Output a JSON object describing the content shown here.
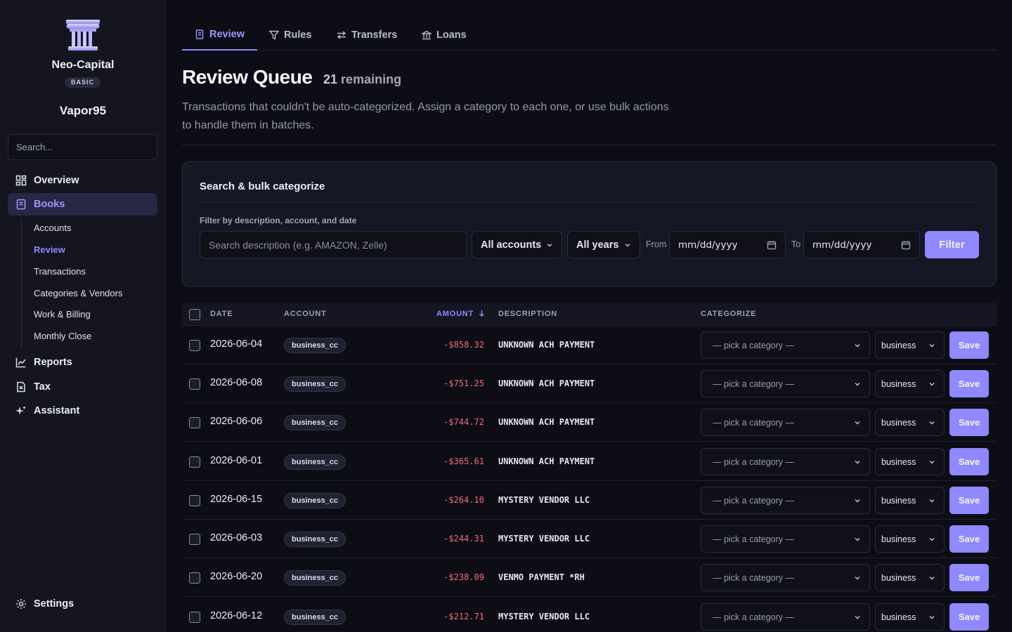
{
  "app": {
    "org_name": "Neo-Capital",
    "plan": "BASIC",
    "user_name": "Vapor95",
    "search_placeholder": "Search..."
  },
  "sidebar": {
    "items": [
      {
        "label": "Overview",
        "icon": "grid-icon"
      },
      {
        "label": "Books",
        "icon": "book-icon",
        "active": true
      },
      {
        "label": "Reports",
        "icon": "chart-icon"
      },
      {
        "label": "Tax",
        "icon": "file-dollar-icon"
      },
      {
        "label": "Assistant",
        "icon": "sparkle-icon"
      }
    ],
    "books_subitems": [
      "Accounts",
      "Review",
      "Transactions",
      "Categories & Vendors",
      "Work & Billing",
      "Monthly Close"
    ],
    "active_subitem": "Review",
    "settings_label": "Settings"
  },
  "tabs": [
    {
      "label": "Review",
      "icon": "review-icon",
      "active": true
    },
    {
      "label": "Rules",
      "icon": "filter-icon"
    },
    {
      "label": "Transfers",
      "icon": "transfer-icon"
    },
    {
      "label": "Loans",
      "icon": "bank-icon"
    }
  ],
  "header": {
    "title": "Review Queue",
    "remaining_count": "21",
    "remaining_label": "remaining",
    "description": "Transactions that couldn't be auto-categorized. Assign a category to each one, or use bulk actions to handle them in batches."
  },
  "bulk_panel": {
    "title": "Search & bulk categorize",
    "filter_label": "Filter by description, account, and date",
    "search_placeholder": "Search description (e.g. AMAZON, Zelle)",
    "account_select": "All accounts",
    "year_select": "All years",
    "from_label": "From",
    "to_label": "To",
    "date_placeholder": "mm/dd/yyyy",
    "filter_button": "Filter"
  },
  "table": {
    "columns": {
      "date": "DATE",
      "account": "ACCOUNT",
      "amount": "AMOUNT",
      "description": "DESCRIPTION",
      "categorize": "CATEGORIZE"
    },
    "category_placeholder": "— pick a category —",
    "type_value": "business",
    "save_label": "Save",
    "rows": [
      {
        "date": "2026-06-04",
        "account": "business_cc",
        "amount": "-$858.32",
        "description": "UNKNOWN ACH PAYMENT"
      },
      {
        "date": "2026-06-08",
        "account": "business_cc",
        "amount": "-$751.25",
        "description": "UNKNOWN ACH PAYMENT"
      },
      {
        "date": "2026-06-06",
        "account": "business_cc",
        "amount": "-$744.72",
        "description": "UNKNOWN ACH PAYMENT"
      },
      {
        "date": "2026-06-01",
        "account": "business_cc",
        "amount": "-$365.61",
        "description": "UNKNOWN ACH PAYMENT"
      },
      {
        "date": "2026-06-15",
        "account": "business_cc",
        "amount": "-$264.10",
        "description": "MYSTERY VENDOR LLC"
      },
      {
        "date": "2026-06-03",
        "account": "business_cc",
        "amount": "-$244.31",
        "description": "MYSTERY VENDOR LLC"
      },
      {
        "date": "2026-06-20",
        "account": "business_cc",
        "amount": "-$238.09",
        "description": "VENMO PAYMENT *RH"
      },
      {
        "date": "2026-06-12",
        "account": "business_cc",
        "amount": "-$212.71",
        "description": "MYSTERY VENDOR LLC"
      }
    ]
  },
  "colors": {
    "accent": "#8f88ff",
    "negative": "#f56a7e",
    "background": "#0d0e15"
  }
}
